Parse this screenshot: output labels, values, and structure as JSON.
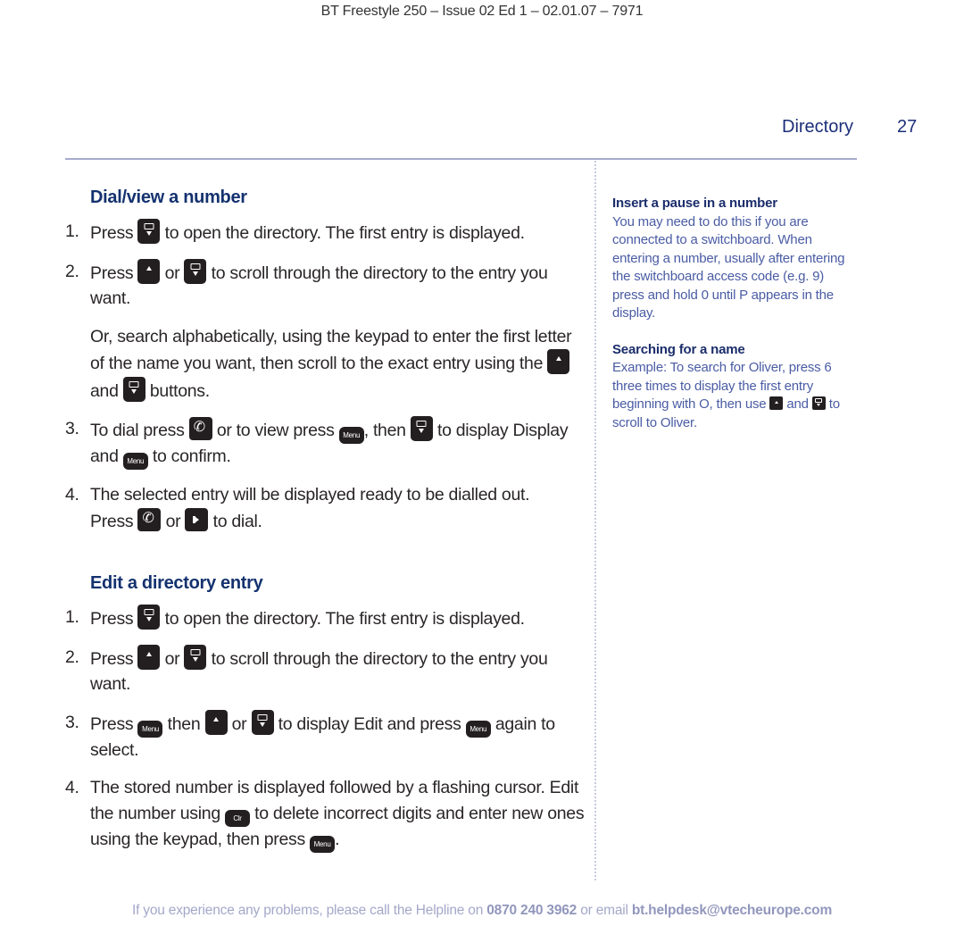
{
  "header": {
    "doc_ref": "BT Freestyle 250 – Issue 02 Ed 1 – 02.01.07 – 7971"
  },
  "page": {
    "section": "Directory",
    "number": "27"
  },
  "dial_view": {
    "heading": "Dial/view a number",
    "step1": {
      "num": "1.",
      "a": "Press",
      "b": "to open the directory. The first entry is displayed."
    },
    "step2": {
      "num": "2.",
      "a": "Press",
      "b": "or",
      "c": "to scroll through the directory to the entry you want."
    },
    "search_para": {
      "a": "Or, search alphabetically, using the keypad to enter the first letter of the name you want, then scroll to the exact entry using the",
      "b": "and",
      "c": "buttons."
    },
    "step3": {
      "num": "3.",
      "a": "To dial press",
      "b": "or to view press",
      "c": ", then",
      "d": "to display",
      "e": "Display",
      "f": "and",
      "g": "to confirm."
    },
    "step4": {
      "num": "4.",
      "a": "The selected entry will be displayed ready to be dialled out.",
      "b": "Press",
      "c": "or",
      "d": "to dial."
    }
  },
  "edit_entry": {
    "heading": "Edit a directory entry",
    "step1": {
      "num": "1.",
      "a": "Press",
      "b": "to open the directory. The first entry is displayed."
    },
    "step2": {
      "num": "2.",
      "a": "Press",
      "b": "or",
      "c": "to scroll through the directory to the entry you want."
    },
    "step3": {
      "num": "3.",
      "a": "Press",
      "b": "then",
      "c": "or",
      "d": "to display Edit  and press",
      "e": "again to select."
    },
    "step4": {
      "num": "4.",
      "a": "The stored number is displayed followed by a flashing cursor. Edit the number using",
      "b": "to delete incorrect digits and enter new ones using the keypad, then press",
      "c": "."
    }
  },
  "keys": {
    "menu": "Menu",
    "clear": "Clr"
  },
  "sidebar": {
    "pause": {
      "heading": "Insert a pause in a number",
      "body": "You may need to do this if you are connected to a switchboard. When entering a number, usually after entering the switchboard access code (e.g. 9) press and hold 0 until P appears in the display."
    },
    "search": {
      "heading": "Searching for a name",
      "body_a": "Example: To search for Oliver, press 6 three times to display the first entry beginning with O, then use",
      "body_b": "and",
      "body_c": "to scroll to Oliver."
    }
  },
  "footer": {
    "text_a": "If you experience any problems, please call the Helpline on",
    "phone": "0870 240 3962",
    "text_b": "or email",
    "email": "bt.helpdesk@vtecheurope.com"
  },
  "colors": {
    "heading_blue": "#14326f",
    "sidebar_text": "#4a5ca4",
    "rule": "#a6abcd",
    "footer": "#a4a8c9"
  }
}
